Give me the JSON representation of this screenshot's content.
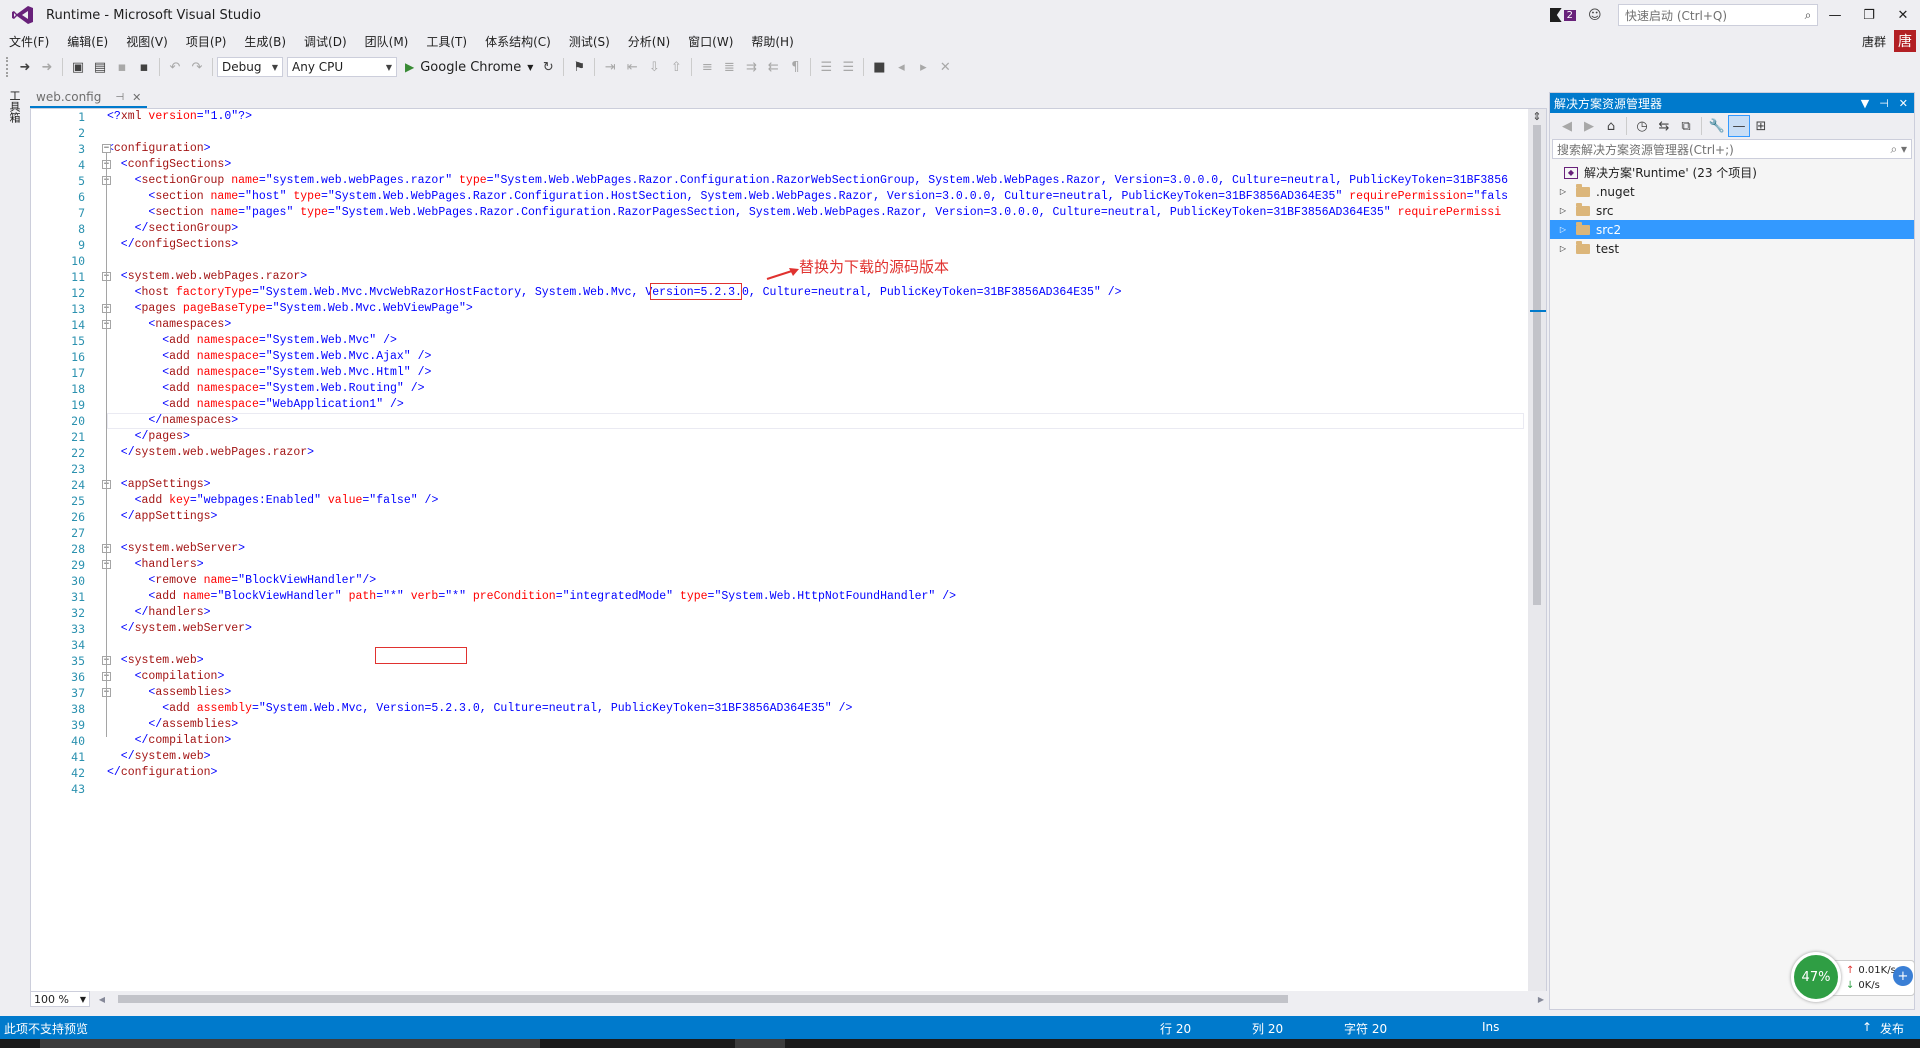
{
  "window": {
    "title": "Runtime - Microsoft Visual Studio",
    "notification_count": "2",
    "quick_launch_placeholder": "快速启动 (Ctrl+Q)",
    "minimize": "—",
    "maximize": "❐",
    "close": "✕"
  },
  "menu": {
    "items": [
      "文件(F)",
      "编辑(E)",
      "视图(V)",
      "项目(P)",
      "生成(B)",
      "调试(D)",
      "团队(M)",
      "工具(T)",
      "体系结构(C)",
      "测试(S)",
      "分析(N)",
      "窗口(W)",
      "帮助(H)"
    ],
    "user_name": "唐群",
    "user_avatar": "唐"
  },
  "toolbar": {
    "configuration": "Debug",
    "platform": "Any CPU",
    "run_target": "Google Chrome"
  },
  "left_strip": {
    "toolbox_label": "工具箱"
  },
  "editor": {
    "tab_title": "web.config",
    "tab_pin": "⊣",
    "tab_close": "✕",
    "zoom": "100 %",
    "annotation": "替换为下载的源码版本",
    "lines": [
      [
        [
          "xb",
          "<?"
        ],
        [
          "xt",
          "xml"
        ],
        [
          "xa",
          " version"
        ],
        [
          "xb",
          "=\""
        ],
        [
          "xv",
          "1.0"
        ],
        [
          "xb",
          "\"?>"
        ]
      ],
      [],
      [
        [
          "xb",
          "<"
        ],
        [
          "xt",
          "configuration"
        ],
        [
          "xb",
          ">"
        ]
      ],
      [
        [
          "xb",
          "  <"
        ],
        [
          "xt",
          "configSections"
        ],
        [
          "xb",
          ">"
        ]
      ],
      [
        [
          "xb",
          "    <"
        ],
        [
          "xt",
          "sectionGroup"
        ],
        [
          "xa",
          " name"
        ],
        [
          "xb",
          "=\""
        ],
        [
          "xv",
          "system.web.webPages.razor"
        ],
        [
          "xb",
          "\""
        ],
        [
          "xa",
          " type"
        ],
        [
          "xb",
          "=\""
        ],
        [
          "xv",
          "System.Web.WebPages.Razor.Configuration.RazorWebSectionGroup, System.Web.WebPages.Razor, Version=3.0.0.0, Culture=neutral, PublicKeyToken=31BF3856"
        ]
      ],
      [
        [
          "xb",
          "      <"
        ],
        [
          "xt",
          "section"
        ],
        [
          "xa",
          " name"
        ],
        [
          "xb",
          "=\""
        ],
        [
          "xv",
          "host"
        ],
        [
          "xb",
          "\""
        ],
        [
          "xa",
          " type"
        ],
        [
          "xb",
          "=\""
        ],
        [
          "xv",
          "System.Web.WebPages.Razor.Configuration.HostSection, System.Web.WebPages.Razor, Version=3.0.0.0, Culture=neutral, PublicKeyToken=31BF3856AD364E35"
        ],
        [
          "xb",
          "\""
        ],
        [
          "xa",
          " requirePermission"
        ],
        [
          "xb",
          "=\""
        ],
        [
          "xv",
          "fals"
        ]
      ],
      [
        [
          "xb",
          "      <"
        ],
        [
          "xt",
          "section"
        ],
        [
          "xa",
          " name"
        ],
        [
          "xb",
          "=\""
        ],
        [
          "xv",
          "pages"
        ],
        [
          "xb",
          "\""
        ],
        [
          "xa",
          " type"
        ],
        [
          "xb",
          "=\""
        ],
        [
          "xv",
          "System.Web.WebPages.Razor.Configuration.RazorPagesSection, System.Web.WebPages.Razor, Version=3.0.0.0, Culture=neutral, PublicKeyToken=31BF3856AD364E35"
        ],
        [
          "xb",
          "\""
        ],
        [
          "xa",
          " requirePermissi"
        ]
      ],
      [
        [
          "xb",
          "    </"
        ],
        [
          "xt",
          "sectionGroup"
        ],
        [
          "xb",
          ">"
        ]
      ],
      [
        [
          "xb",
          "  </"
        ],
        [
          "xt",
          "configSections"
        ],
        [
          "xb",
          ">"
        ]
      ],
      [],
      [
        [
          "xb",
          "  <"
        ],
        [
          "xt",
          "system.web.webPages.razor"
        ],
        [
          "xb",
          ">"
        ]
      ],
      [
        [
          "xb",
          "    <"
        ],
        [
          "xt",
          "host"
        ],
        [
          "xa",
          " factoryType"
        ],
        [
          "xb",
          "=\""
        ],
        [
          "xv",
          "System.Web.Mvc.MvcWebRazorHostFactory, System.Web.Mvc, Version=5.2.3.0, Culture=neutral, PublicKeyToken=31BF3856AD364E35"
        ],
        [
          "xb",
          "\" />"
        ]
      ],
      [
        [
          "xb",
          "    <"
        ],
        [
          "xt",
          "pages"
        ],
        [
          "xa",
          " pageBaseType"
        ],
        [
          "xb",
          "=\""
        ],
        [
          "xv",
          "System.Web.Mvc.WebViewPage"
        ],
        [
          "xb",
          "\">"
        ]
      ],
      [
        [
          "xb",
          "      <"
        ],
        [
          "xt",
          "namespaces"
        ],
        [
          "xb",
          ">"
        ]
      ],
      [
        [
          "xb",
          "        <"
        ],
        [
          "xt",
          "add"
        ],
        [
          "xa",
          " namespace"
        ],
        [
          "xb",
          "=\""
        ],
        [
          "xv",
          "System.Web.Mvc"
        ],
        [
          "xb",
          "\" />"
        ]
      ],
      [
        [
          "xb",
          "        <"
        ],
        [
          "xt",
          "add"
        ],
        [
          "xa",
          " namespace"
        ],
        [
          "xb",
          "=\""
        ],
        [
          "xv",
          "System.Web.Mvc.Ajax"
        ],
        [
          "xb",
          "\" />"
        ]
      ],
      [
        [
          "xb",
          "        <"
        ],
        [
          "xt",
          "add"
        ],
        [
          "xa",
          " namespace"
        ],
        [
          "xb",
          "=\""
        ],
        [
          "xv",
          "System.Web.Mvc.Html"
        ],
        [
          "xb",
          "\" />"
        ]
      ],
      [
        [
          "xb",
          "        <"
        ],
        [
          "xt",
          "add"
        ],
        [
          "xa",
          " namespace"
        ],
        [
          "xb",
          "=\""
        ],
        [
          "xv",
          "System.Web.Routing"
        ],
        [
          "xb",
          "\" />"
        ]
      ],
      [
        [
          "xb",
          "        <"
        ],
        [
          "xt",
          "add"
        ],
        [
          "xa",
          " namespace"
        ],
        [
          "xb",
          "=\""
        ],
        [
          "xv",
          "WebApplication1"
        ],
        [
          "xb",
          "\" />"
        ]
      ],
      [
        [
          "xb",
          "      </"
        ],
        [
          "xt",
          "namespaces"
        ],
        [
          "xb",
          ">"
        ]
      ],
      [
        [
          "xb",
          "    </"
        ],
        [
          "xt",
          "pages"
        ],
        [
          "xb",
          ">"
        ]
      ],
      [
        [
          "xb",
          "  </"
        ],
        [
          "xt",
          "system.web.webPages.razor"
        ],
        [
          "xb",
          ">"
        ]
      ],
      [],
      [
        [
          "xb",
          "  <"
        ],
        [
          "xt",
          "appSettings"
        ],
        [
          "xb",
          ">"
        ]
      ],
      [
        [
          "xb",
          "    <"
        ],
        [
          "xt",
          "add"
        ],
        [
          "xa",
          " key"
        ],
        [
          "xb",
          "=\""
        ],
        [
          "xv",
          "webpages:Enabled"
        ],
        [
          "xb",
          "\""
        ],
        [
          "xa",
          " value"
        ],
        [
          "xb",
          "=\""
        ],
        [
          "xv",
          "false"
        ],
        [
          "xb",
          "\" />"
        ]
      ],
      [
        [
          "xb",
          "  </"
        ],
        [
          "xt",
          "appSettings"
        ],
        [
          "xb",
          ">"
        ]
      ],
      [],
      [
        [
          "xb",
          "  <"
        ],
        [
          "xt",
          "system.webServer"
        ],
        [
          "xb",
          ">"
        ]
      ],
      [
        [
          "xb",
          "    <"
        ],
        [
          "xt",
          "handlers"
        ],
        [
          "xb",
          ">"
        ]
      ],
      [
        [
          "xb",
          "      <"
        ],
        [
          "xt",
          "remove"
        ],
        [
          "xa",
          " name"
        ],
        [
          "xb",
          "=\""
        ],
        [
          "xv",
          "BlockViewHandler"
        ],
        [
          "xb",
          "\"/>"
        ]
      ],
      [
        [
          "xb",
          "      <"
        ],
        [
          "xt",
          "add"
        ],
        [
          "xa",
          " name"
        ],
        [
          "xb",
          "=\""
        ],
        [
          "xv",
          "BlockViewHandler"
        ],
        [
          "xb",
          "\""
        ],
        [
          "xa",
          " path"
        ],
        [
          "xb",
          "=\""
        ],
        [
          "xv",
          "*"
        ],
        [
          "xb",
          "\""
        ],
        [
          "xa",
          " verb"
        ],
        [
          "xb",
          "=\""
        ],
        [
          "xv",
          "*"
        ],
        [
          "xb",
          "\""
        ],
        [
          "xa",
          " preCondition"
        ],
        [
          "xb",
          "=\""
        ],
        [
          "xv",
          "integratedMode"
        ],
        [
          "xb",
          "\""
        ],
        [
          "xa",
          " type"
        ],
        [
          "xb",
          "=\""
        ],
        [
          "xv",
          "System.Web.HttpNotFoundHandler"
        ],
        [
          "xb",
          "\" />"
        ]
      ],
      [
        [
          "xb",
          "    </"
        ],
        [
          "xt",
          "handlers"
        ],
        [
          "xb",
          ">"
        ]
      ],
      [
        [
          "xb",
          "  </"
        ],
        [
          "xt",
          "system.webServer"
        ],
        [
          "xb",
          ">"
        ]
      ],
      [],
      [
        [
          "xb",
          "  <"
        ],
        [
          "xt",
          "system.web"
        ],
        [
          "xb",
          ">"
        ]
      ],
      [
        [
          "xb",
          "    <"
        ],
        [
          "xt",
          "compilation"
        ],
        [
          "xb",
          ">"
        ]
      ],
      [
        [
          "xb",
          "      <"
        ],
        [
          "xt",
          "assemblies"
        ],
        [
          "xb",
          ">"
        ]
      ],
      [
        [
          "xb",
          "        <"
        ],
        [
          "xt",
          "add"
        ],
        [
          "xa",
          " assembly"
        ],
        [
          "xb",
          "=\""
        ],
        [
          "xv",
          "System.Web.Mvc, Version=5.2.3.0, Culture=neutral, PublicKeyToken=31BF3856AD364E35"
        ],
        [
          "xb",
          "\" />"
        ]
      ],
      [
        [
          "xb",
          "      </"
        ],
        [
          "xt",
          "assemblies"
        ],
        [
          "xb",
          ">"
        ]
      ],
      [
        [
          "xb",
          "    </"
        ],
        [
          "xt",
          "compilation"
        ],
        [
          "xb",
          ">"
        ]
      ],
      [
        [
          "xb",
          "  </"
        ],
        [
          "xt",
          "system.web"
        ],
        [
          "xb",
          ">"
        ]
      ],
      [
        [
          "xb",
          "</"
        ],
        [
          "xt",
          "configuration"
        ],
        [
          "xb",
          ">"
        ]
      ],
      []
    ]
  },
  "solution_explorer": {
    "title": "解决方案资源管理器",
    "search_placeholder": "搜索解决方案资源管理器(Ctrl+;)",
    "solution_label": "解决方案'Runtime' (23 个项目)",
    "folders": [
      ".nuget",
      "src",
      "src2",
      "test"
    ],
    "selected_folder": "src2"
  },
  "network_widget": {
    "percent": "47%",
    "upload": "0.01K/s",
    "download": "0K/s"
  },
  "statusbar": {
    "message": "此项不支持预览",
    "line": "行 20",
    "column": "列 20",
    "char": "字符 20",
    "mode": "Ins",
    "publish": "发布"
  },
  "colors": {
    "accent": "#007acc",
    "annotation_red": "#e0322f",
    "selection": "#3399ff"
  }
}
